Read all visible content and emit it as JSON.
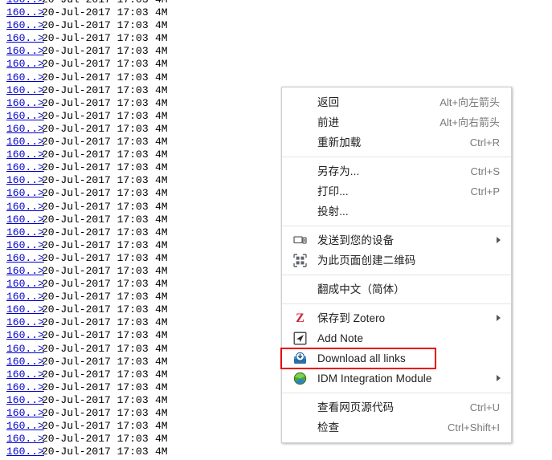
{
  "file_listing": {
    "row_count": 36,
    "columns": [
      "name",
      "date",
      "size"
    ],
    "link_label": "160..>",
    "date": "20-Jul-2017 17:03",
    "size": "4M",
    "link_color": "#0000cc"
  },
  "context_menu": {
    "highlight_color": "#e60000",
    "sections": [
      {
        "items": [
          {
            "label": "返回",
            "accel": "Alt+向左箭头",
            "icon": null,
            "submenu": false
          },
          {
            "label": "前进",
            "accel": "Alt+向右箭头",
            "icon": null,
            "submenu": false
          },
          {
            "label": "重新加载",
            "accel": "Ctrl+R",
            "icon": null,
            "submenu": false
          }
        ]
      },
      {
        "items": [
          {
            "label": "另存为...",
            "accel": "Ctrl+S",
            "icon": null,
            "submenu": false
          },
          {
            "label": "打印...",
            "accel": "Ctrl+P",
            "icon": null,
            "submenu": false
          },
          {
            "label": "投射...",
            "accel": "",
            "icon": null,
            "submenu": false
          }
        ]
      },
      {
        "items": [
          {
            "label": "发送到您的设备",
            "accel": "",
            "icon": "devices-icon",
            "submenu": true
          },
          {
            "label": "为此页面创建二维码",
            "accel": "",
            "icon": "qr-code-icon",
            "submenu": false
          }
        ]
      },
      {
        "items": [
          {
            "label": "翻成中文（简体）",
            "accel": "",
            "icon": null,
            "submenu": false
          }
        ]
      },
      {
        "items": [
          {
            "label": "保存到 Zotero",
            "accel": "",
            "icon": "zotero-icon",
            "submenu": true
          },
          {
            "label": "Add Note",
            "accel": "",
            "icon": "add-note-icon",
            "submenu": false
          },
          {
            "label": "Download all links",
            "accel": "",
            "icon": "download-all-links-icon",
            "submenu": false,
            "highlighted": true
          },
          {
            "label": "IDM Integration Module",
            "accel": "",
            "icon": "idm-icon",
            "submenu": true
          }
        ]
      },
      {
        "items": [
          {
            "label": "查看网页源代码",
            "accel": "Ctrl+U",
            "icon": null,
            "submenu": false
          },
          {
            "label": "检查",
            "accel": "Ctrl+Shift+I",
            "icon": null,
            "submenu": false
          }
        ]
      }
    ]
  }
}
